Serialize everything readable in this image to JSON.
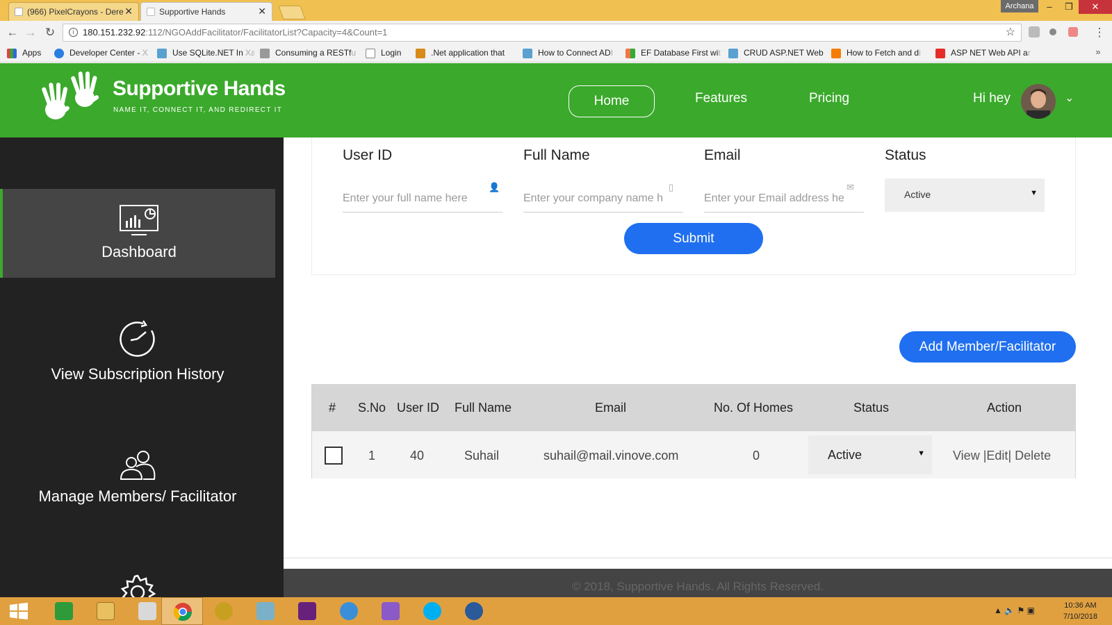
{
  "browser": {
    "tabs": [
      {
        "title": "(966) PixelCrayons - Dere",
        "active": false
      },
      {
        "title": "Supportive Hands",
        "active": true
      }
    ],
    "user_badge": "Archana",
    "url_host": "180.151.232.92",
    "url_path": ":112/NGOAddFacilitator/FacilitatorList?Capacity=4&Count=1",
    "bookmarks": [
      {
        "label": "Apps",
        "icon": "apps-grid-icon",
        "color": "#d44"
      },
      {
        "label": "Developer Center - ",
        "faded": "X",
        "icon": "xamarin-icon",
        "color": "#2a7de1"
      },
      {
        "label": "Use SQLite.NET In ",
        "faded": "Xa",
        "icon": "sqlite-icon",
        "color": "#5aa0d0"
      },
      {
        "label": "Consuming a RESTf",
        "faded": "u",
        "icon": "list-icon",
        "color": "#777"
      },
      {
        "label": "Login",
        "faded": "",
        "icon": "page-icon",
        "color": "#eee"
      },
      {
        "label": ".Net application that",
        "faded": "",
        "icon": "gear-fav-icon",
        "color": "#d88a1a"
      },
      {
        "label": "How to Connect AD",
        "faded": "I",
        "icon": "sqlite-icon",
        "color": "#5aa0d0"
      },
      {
        "label": "EF Database First wi",
        "faded": "t",
        "icon": "windows-fav-icon",
        "color": "#e74"
      },
      {
        "label": "CRUD ASP.NET Web",
        "faded": "",
        "icon": "sqlite-icon",
        "color": "#5aa0d0"
      },
      {
        "label": "How to Fetch and d",
        "faded": "i",
        "icon": "blogger-icon",
        "color": "#f57d00"
      },
      {
        "label": "ASP NET Web API a",
        "faded": "r",
        "icon": "youtube-icon",
        "color": "#e52d27"
      }
    ]
  },
  "site": {
    "brand": "Supportive Hands",
    "tagline": "NAME IT, CONNECT IT, AND  REDIRECT IT",
    "nav": {
      "home": "Home",
      "features": "Features",
      "pricing": "Pricing"
    },
    "greeting": "Hi hey"
  },
  "sidebar": {
    "items": [
      {
        "label": "Dashboard",
        "icon": "dashboard-monitor-icon",
        "active": true
      },
      {
        "label": "View Subscription History",
        "icon": "history-clock-icon",
        "active": false
      },
      {
        "label": "Manage Members/ Facilitator",
        "icon": "people-icon",
        "active": false
      },
      {
        "label": "",
        "icon": "settings-gear-icon",
        "active": false
      }
    ]
  },
  "form": {
    "user_id_label": "User ID",
    "user_id_placeholder": "Enter your full name here",
    "full_name_label": "Full Name",
    "full_name_placeholder": "Enter your company name h",
    "email_label": "Email",
    "email_placeholder": "Enter your Email address he",
    "status_label": "Status",
    "status_value": "Active",
    "submit_label": "Submit"
  },
  "add_button_label": "Add Member/Facilitator",
  "table": {
    "headers": [
      "#",
      "S.No",
      "User ID",
      "Full Name",
      "Email",
      "No. Of Homes",
      "Status",
      "Action"
    ],
    "rows": [
      {
        "sno": "1",
        "user_id": "40",
        "full_name": "Suhail",
        "email": "suhail@mail.vinove.com",
        "homes": "0",
        "status": "Active",
        "view": "View",
        "edit": "Edit",
        "delete": "Delete"
      }
    ]
  },
  "footer": "© 2018, Supportive Hands. All Rights Reserved.",
  "taskbar": {
    "time": "10:36 AM",
    "date": "7/10/2018"
  },
  "colors": {
    "brand_green": "#3ba92c",
    "primary_blue": "#1f6ff0",
    "sidebar_bg": "#222222"
  }
}
